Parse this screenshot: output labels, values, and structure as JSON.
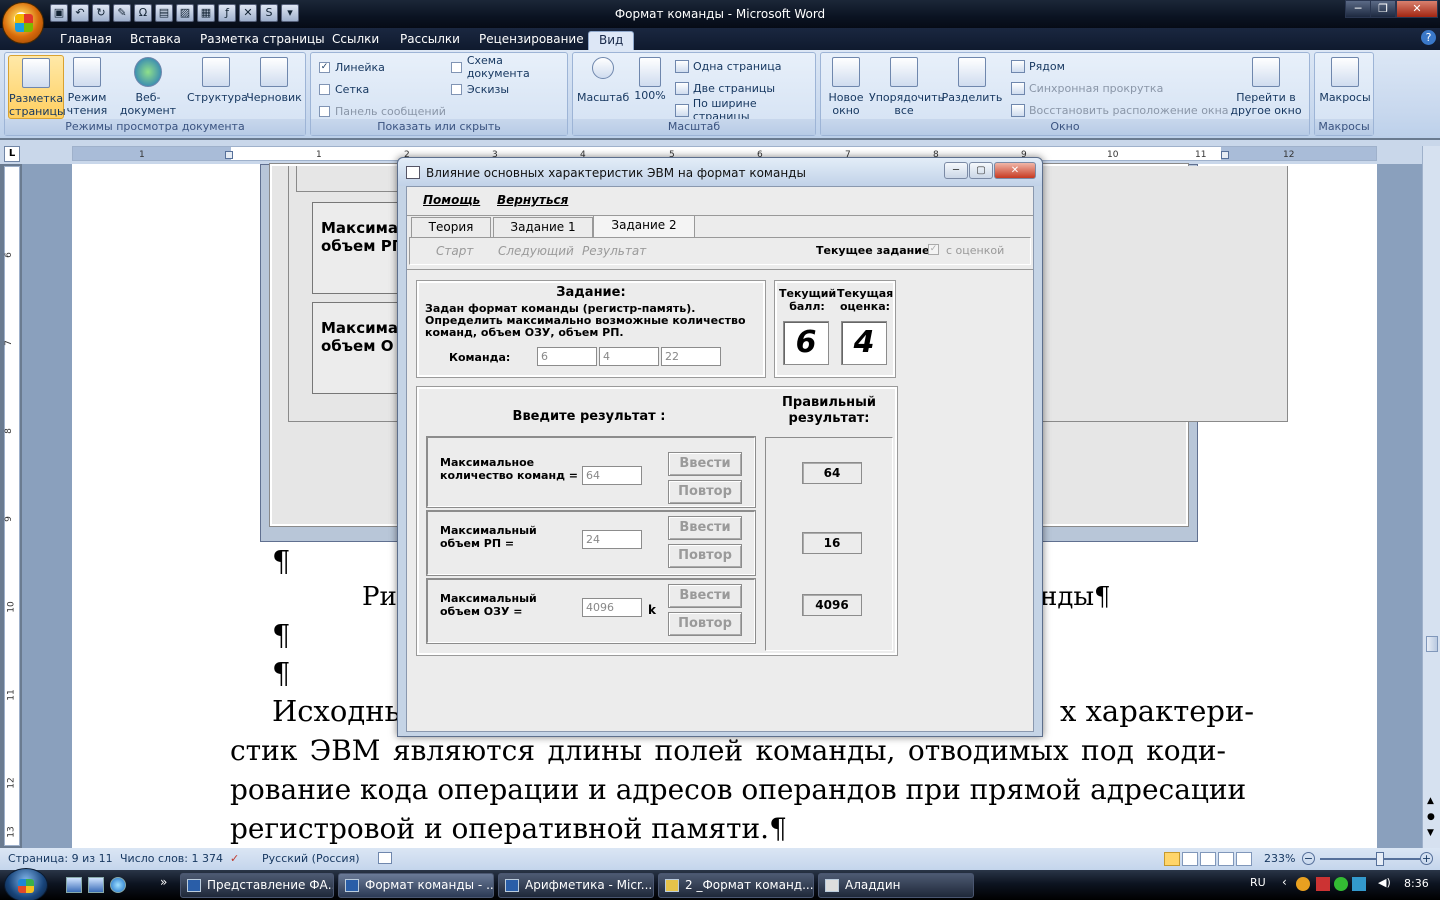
{
  "window": {
    "title": "Формат команды - Microsoft Word"
  },
  "ribbon": {
    "tabs": [
      "Главная",
      "Вставка",
      "Разметка страницы",
      "Ссылки",
      "Рассылки",
      "Рецензирование",
      "Вид"
    ],
    "views": {
      "label": "Режимы просмотра документа",
      "buttons": [
        {
          "l1": "Разметка",
          "l2": "страницы"
        },
        {
          "l1": "Режим",
          "l2": "чтения"
        },
        {
          "l1": "Веб-документ",
          "l2": ""
        },
        {
          "l1": "Структура",
          "l2": ""
        },
        {
          "l1": "Черновик",
          "l2": ""
        }
      ]
    },
    "show": {
      "label": "Показать или скрыть",
      "ruler": "Линейка",
      "grid": "Сетка",
      "msgbar": "Панель сообщений",
      "docmap": "Схема документа",
      "thumbs": "Эскизы"
    },
    "zoom": {
      "label": "Масштаб",
      "zoom": "Масштаб",
      "p100": "100%",
      "one": "Одна страница",
      "two": "Две страницы",
      "width": "По ширине страницы"
    },
    "window": {
      "label": "Окно",
      "new1": "Новое",
      "new2": "окно",
      "arr1": "Упорядочить",
      "arr2": "все",
      "split": "Разделить",
      "side": "Рядом",
      "sync": "Синхронная прокрутка",
      "reset": "Восстановить расположение окна",
      "sw1": "Перейти в",
      "sw2": "другое окно"
    },
    "macros": {
      "label": "Макросы",
      "btn": "Макросы"
    }
  },
  "ruler": {
    "h": [
      "1",
      "1",
      "2",
      "3",
      "4",
      "5",
      "6",
      "7",
      "8",
      "9",
      "10",
      "11",
      "12"
    ],
    "v": [
      "6",
      "7",
      "8",
      "9",
      "10",
      "11",
      "12",
      "13"
    ]
  },
  "doc": {
    "box1": {
      "l1": "Максима",
      "l2": "объем РП"
    },
    "box2": {
      "l1": "Максима",
      "l2": "объем О"
    },
    "pilcrow": "¶",
    "caption_left": "Ри",
    "caption_right": "нды¶",
    "p1a": "Исходны",
    "p1b": "х характери-",
    "p2": "стик ЭВМ являются длины полей команды, отводимых под коди-",
    "p3": "рование кода операции и адресов операндов при прямой адресации",
    "p4": "регистровой и оперативной памяти.¶"
  },
  "dialog": {
    "title": "Влияние основных характеристик ЭВМ на формат команды",
    "menu": [
      "Помощь",
      "Вернуться"
    ],
    "tabs": [
      "Теория",
      "Задание 1",
      "Задание 2"
    ],
    "toolbar": {
      "start": "Старт",
      "next": "Следующий",
      "result": "Результат",
      "current": "Текущее задание",
      "graded": "с оценкой"
    },
    "task": {
      "heading": "Задание:",
      "text": "Задан формат команды (регистр-память). Определить максимально возможные количество команд, объем ОЗУ, объем РП.",
      "cmd_label": "Команда:",
      "f1": "6",
      "f2": "4",
      "f3": "22"
    },
    "score": {
      "ball1": "Текущий",
      "ball2": "балл:",
      "grade1": "Текущая",
      "grade2": "оценка:",
      "ball": "6",
      "grade": "4"
    },
    "input": {
      "heading": "Введите результат :",
      "rows": [
        {
          "l1": "Максимальное",
          "l2": "количество команд =",
          "value": "64",
          "unit": ""
        },
        {
          "l1": "Максимальный",
          "l2": "объем РП =",
          "value": "24",
          "unit": ""
        },
        {
          "l1": "Максимальный",
          "l2": "объем ОЗУ =",
          "value": "4096",
          "unit": "k"
        }
      ],
      "enter": "Ввести",
      "repeat": "Повтор"
    },
    "correct": {
      "h1": "Правильный",
      "h2": "результат:",
      "values": [
        "64",
        "16",
        "4096"
      ]
    }
  },
  "status": {
    "page": "Страница: 9 из 11",
    "words": "Число слов: 1 374",
    "lang": "Русский (Россия)",
    "zoom": "233%"
  },
  "taskbar": {
    "items": [
      "Представление ФА...",
      "Формат команды - ...",
      "Арифметика - Micr...",
      "2 _Формат команд...",
      "Аладдин"
    ],
    "lang": "RU",
    "time": "8:36"
  }
}
